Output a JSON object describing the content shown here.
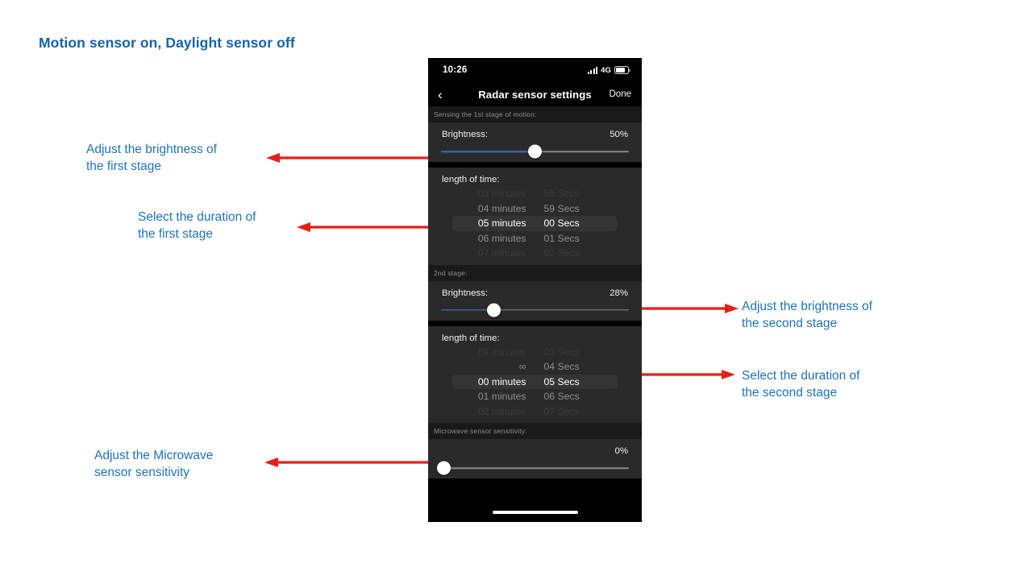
{
  "slide": {
    "title": "Motion sensor on, Daylight sensor off",
    "title_color": "#1663ad",
    "annotation_color": "#1f72bd",
    "arrow_color": "#ee1c17"
  },
  "annotations": [
    {
      "id": "a1",
      "text": "Adjust the brightness of\nthe first stage"
    },
    {
      "id": "a2",
      "text": "Select the duration of\nthe first stage"
    },
    {
      "id": "a3",
      "text": "Adjust the brightness of\nthe second stage"
    },
    {
      "id": "a4",
      "text": "Select the duration of\nthe second stage"
    },
    {
      "id": "a5",
      "text": "Adjust the Microwave\nsensor sensitivity"
    }
  ],
  "phone": {
    "status_bar": {
      "time": "10:26",
      "network": "4G",
      "signal_icon": "cellular-signal-icon",
      "battery_icon": "battery-icon"
    },
    "nav_bar": {
      "back_icon": "chevron-left-icon",
      "title": "Radar sensor settings",
      "done_label": "Done"
    },
    "sections": [
      {
        "header": "Sensing the 1st stage of motion:",
        "brightness": {
          "label": "Brightness:",
          "value": "50%",
          "percent": 50
        },
        "duration": {
          "label": "length of time:",
          "rows": [
            {
              "minutes": "03 minutes",
              "seconds": "58 Secs",
              "state": "faded2"
            },
            {
              "minutes": "04 minutes",
              "seconds": "59 Secs",
              "state": "faded1"
            },
            {
              "minutes": "05 minutes",
              "seconds": "00 Secs",
              "state": "selected"
            },
            {
              "minutes": "06 minutes",
              "seconds": "01 Secs",
              "state": "faded1"
            },
            {
              "minutes": "07 minutes",
              "seconds": "02 Secs",
              "state": "faded2"
            }
          ]
        }
      },
      {
        "header": "2nd stage:",
        "brightness": {
          "label": "Brightness:",
          "value": "28%",
          "percent": 28
        },
        "duration": {
          "label": "length of time:",
          "rows": [
            {
              "minutes": "59 minutes",
              "seconds": "03 Secs",
              "state": "faded2"
            },
            {
              "minutes": "∞",
              "seconds": "04 Secs",
              "state": "faded1"
            },
            {
              "minutes": "00 minutes",
              "seconds": "05 Secs",
              "state": "selected"
            },
            {
              "minutes": "01 minutes",
              "seconds": "06 Secs",
              "state": "faded1"
            },
            {
              "minutes": "02 minutes",
              "seconds": "07 Secs",
              "state": "faded2"
            }
          ]
        }
      }
    ],
    "microwave": {
      "header": "Microwave sensor sensitivity:",
      "value": "0%",
      "percent": 0
    },
    "home_indicator": "home-indicator"
  }
}
